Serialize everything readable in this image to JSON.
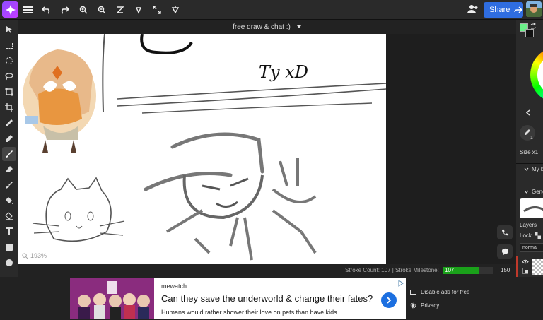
{
  "header": {
    "share_label": "Share"
  },
  "title": {
    "text": "free draw & chat :)"
  },
  "canvas": {
    "zoom": "193%",
    "drawn_text": "Ty xD"
  },
  "status": {
    "stroke_count": "Stroke Count: 107 | Stroke Milestone:",
    "milestone_value": "107",
    "milestone_max": "150",
    "milestone_progress": 0.713
  },
  "right_panel": {
    "size_label": "Size x1",
    "brush_value": "1",
    "brush_section": "My b",
    "general_section": "Gene",
    "layers_label": "Layers",
    "lock_label": "Lock",
    "blend_mode": "normal"
  },
  "ad": {
    "brand": "mewatch",
    "headline": "Can they save the underworld & change their fates?",
    "subtext": "Humans would rather shower their love on pets than have kids.",
    "disable_ads": "Disable ads for free",
    "privacy": "Privacy"
  },
  "colors": {
    "primary_color": "#6bf08a",
    "accent": "#2f6de0",
    "milestone_fill": "#1aa11a"
  }
}
